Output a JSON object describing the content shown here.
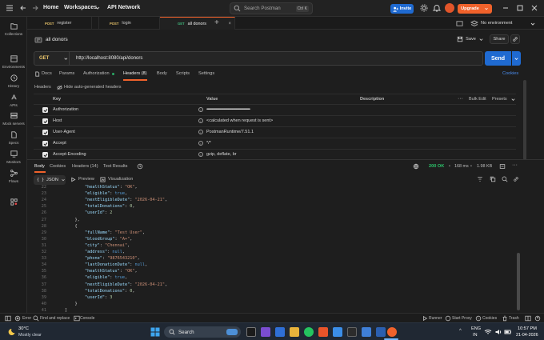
{
  "titlebar": {
    "home": "Home",
    "workspaces": "Workspaces",
    "workspace_name": "API Network",
    "search_placeholder": "Search Postman",
    "search_shortcut": "Ctrl K",
    "invite": "Invite",
    "upgrade": "Upgrade"
  },
  "sidebar": {
    "items": [
      {
        "label": "Collections"
      },
      {
        "label": "Environments"
      },
      {
        "label": "History"
      },
      {
        "label": "APIs"
      },
      {
        "label": "Mock servers"
      },
      {
        "label": "Specs"
      },
      {
        "label": "Monitors"
      },
      {
        "label": "Flows"
      }
    ]
  },
  "tabs": [
    {
      "method": "POST",
      "name": "register"
    },
    {
      "method": "POST",
      "name": "login"
    },
    {
      "method": "GET",
      "name": "all donors"
    }
  ],
  "environment": "No environment",
  "request": {
    "name": "all donors",
    "method": "GET",
    "url": "http://localhost:8080/api/donors",
    "save": "Save",
    "share": "Share",
    "send": "Send"
  },
  "request_tabs": [
    {
      "label": "Docs"
    },
    {
      "label": "Params"
    },
    {
      "label": "Authorization"
    },
    {
      "label": "Headers (8)"
    },
    {
      "label": "Body"
    },
    {
      "label": "Scripts"
    },
    {
      "label": "Settings"
    }
  ],
  "cookies_link": "Cookies",
  "headers_section": {
    "title": "Headers",
    "hide_auto": "Hide auto-generated headers",
    "col_key": "Key",
    "col_value": "Value",
    "col_desc": "Description",
    "bulk_edit": "Bulk Edit",
    "presets": "Presets",
    "rows": [
      {
        "key": "Authorization",
        "value": "••••••••••••••••••••••••••••••••••••••••••••••••••••••••••••••••••••••••••••••••••••••"
      },
      {
        "key": "Host",
        "value": "<calculated when request is sent>"
      },
      {
        "key": "User-Agent",
        "value": "PostmanRuntime/7.51.1"
      },
      {
        "key": "Accept",
        "value": "*/*"
      },
      {
        "key": "Accept-Encoding",
        "value": "gzip, deflate, br"
      }
    ]
  },
  "response": {
    "tabs": [
      {
        "label": "Body"
      },
      {
        "label": "Cookies"
      },
      {
        "label": "Headers (14)"
      },
      {
        "label": "Test Results"
      }
    ],
    "status": "200 OK",
    "time": "168 ms",
    "size": "1.98 KB",
    "format": "JSON",
    "preview": "Preview",
    "visualize": "Visualization",
    "lines": [
      {
        "n": "22",
        "t": "        \"healthStatus\": \"OK\","
      },
      {
        "n": "23",
        "t": "        \"eligible\": true,"
      },
      {
        "n": "24",
        "t": "        \"nextEligibleDate\": \"2026-04-21\","
      },
      {
        "n": "25",
        "t": "        \"totalDonations\": 0,"
      },
      {
        "n": "26",
        "t": "        \"userId\": 2"
      },
      {
        "n": "27",
        "t": "    },"
      },
      {
        "n": "28",
        "t": "    {"
      },
      {
        "n": "29",
        "t": "        \"fullName\": \"Test User\","
      },
      {
        "n": "30",
        "t": "        \"bloodGroup\": \"A+\","
      },
      {
        "n": "31",
        "t": "        \"city\": \"Chennai\","
      },
      {
        "n": "32",
        "t": "        \"address\": null,"
      },
      {
        "n": "33",
        "t": "        \"phone\": \"9876543210\","
      },
      {
        "n": "34",
        "t": "        \"lastDonationDate\": null,"
      },
      {
        "n": "35",
        "t": "        \"healthStatus\": \"OK\","
      },
      {
        "n": "36",
        "t": "        \"eligible\": true,"
      },
      {
        "n": "37",
        "t": "        \"nextEligibleDate\": \"2026-04-21\","
      },
      {
        "n": "38",
        "t": "        \"totalDonations\": 0,"
      },
      {
        "n": "39",
        "t": "        \"userId\": 3"
      },
      {
        "n": "40",
        "t": "    }"
      },
      {
        "n": "41",
        "t": "]"
      }
    ]
  },
  "statusbar": {
    "error": "Error",
    "find": "Find and replace",
    "console": "Console",
    "runner": "Runner",
    "proxy": "Start Proxy",
    "cookies": "Cookies",
    "trash": "Trash"
  },
  "taskbar": {
    "weather_temp": "30°C",
    "weather_desc": "Mostly clear",
    "search": "Search",
    "lang1": "ENG",
    "lang2": "IN",
    "time": "10:57 PM",
    "date": "21-04-2026"
  }
}
